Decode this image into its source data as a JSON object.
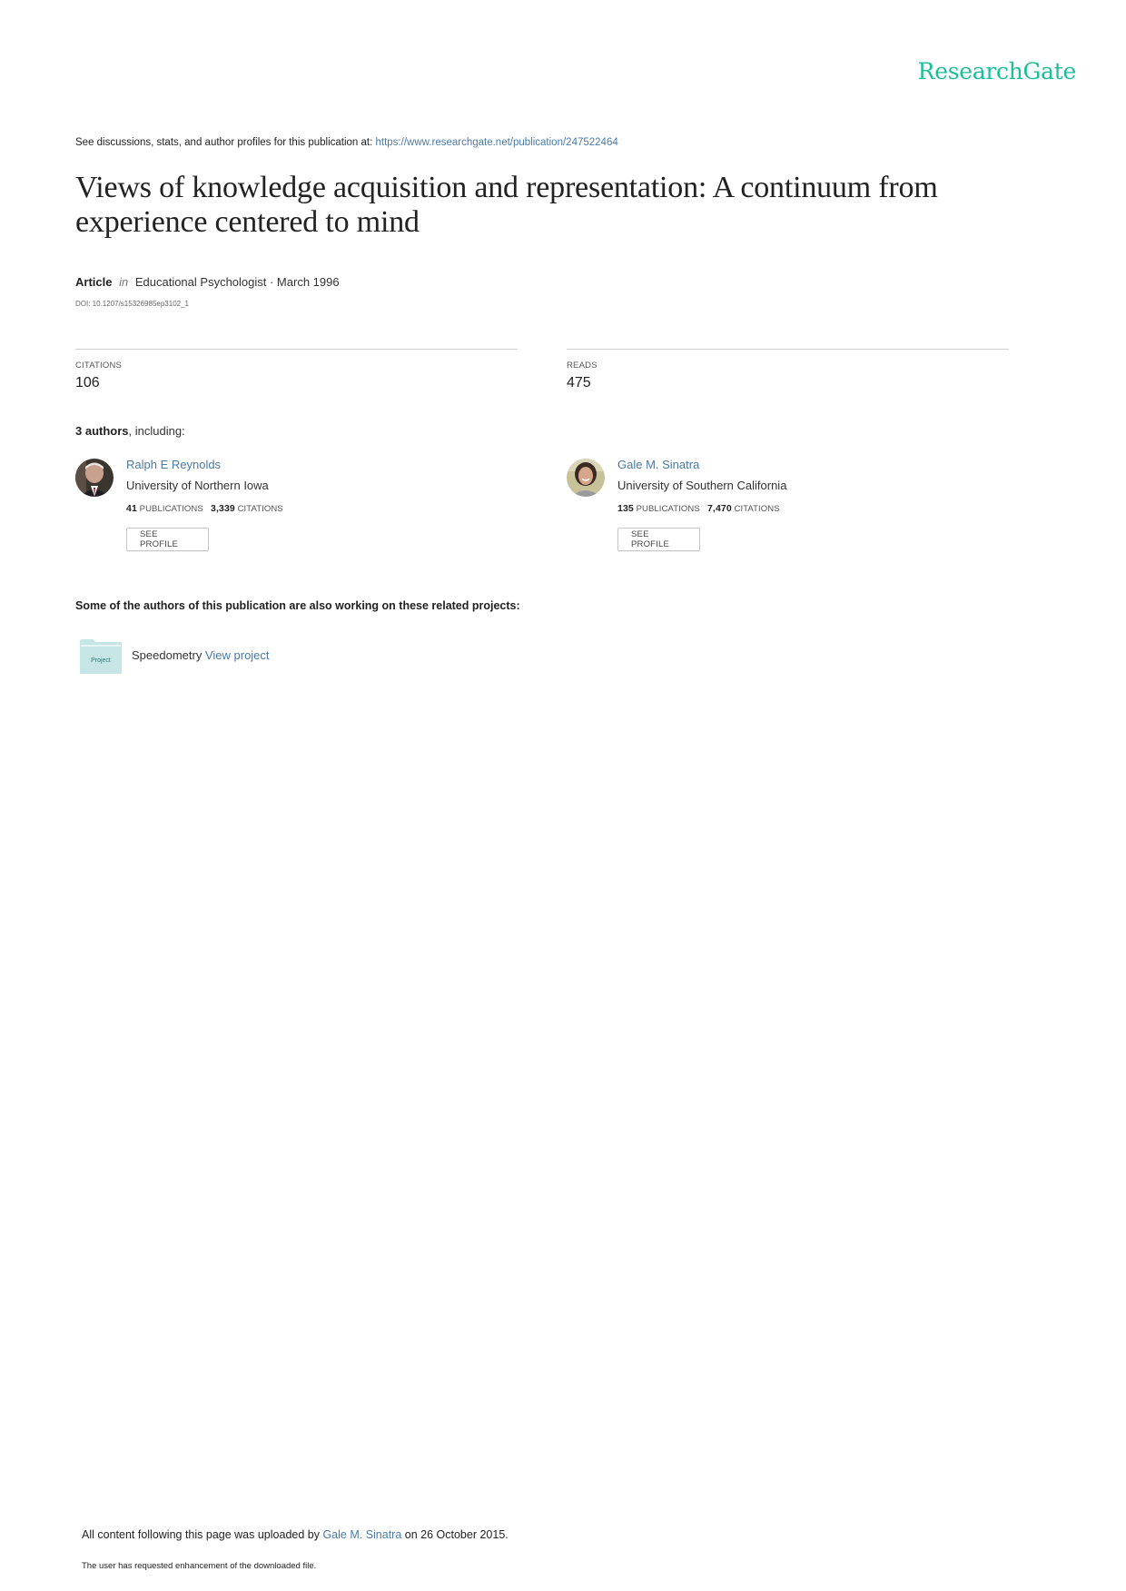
{
  "brand": {
    "logo_text": "ResearchGate",
    "accent_color": "#1bbf9a",
    "link_color": "#4a7aa7"
  },
  "header": {
    "see_text": "See discussions, stats, and author profiles for this publication at: ",
    "publication_url": "https://www.researchgate.net/publication/247522464"
  },
  "publication": {
    "title": "Views of knowledge acquisition and representation: A continuum from experience centered to mind",
    "type": "Article",
    "in_word": "in",
    "journal_date": "Educational Psychologist · March 1996",
    "doi": "DOI: 10.1207/s15326985ep3102_1"
  },
  "stats": {
    "citations_label": "CITATIONS",
    "citations_value": "106",
    "reads_label": "READS",
    "reads_value": "475"
  },
  "authors": {
    "count_bold": "3 authors",
    "count_rest": ", including:",
    "list": [
      {
        "name": "Ralph E Reynolds",
        "affiliation": "University of Northern Iowa",
        "publications": "41",
        "publications_label": "PUBLICATIONS",
        "citations": "3,339",
        "citations_label": "CITATIONS",
        "button": "SEE PROFILE"
      },
      {
        "name": "Gale M. Sinatra",
        "affiliation": "University of Southern California",
        "publications": "135",
        "publications_label": "PUBLICATIONS",
        "citations": "7,470",
        "citations_label": "CITATIONS",
        "button": "SEE PROFILE"
      }
    ]
  },
  "related": {
    "heading": "Some of the authors of this publication are also working on these related projects:",
    "projects": [
      {
        "icon_label": "Project",
        "name": "Speedometry",
        "link": "View project"
      }
    ]
  },
  "footer": {
    "uploaded_prefix": "All content following this page was uploaded by ",
    "uploader": "Gale M. Sinatra",
    "uploaded_suffix": " on 26 October 2015.",
    "note": "The user has requested enhancement of the downloaded file."
  }
}
